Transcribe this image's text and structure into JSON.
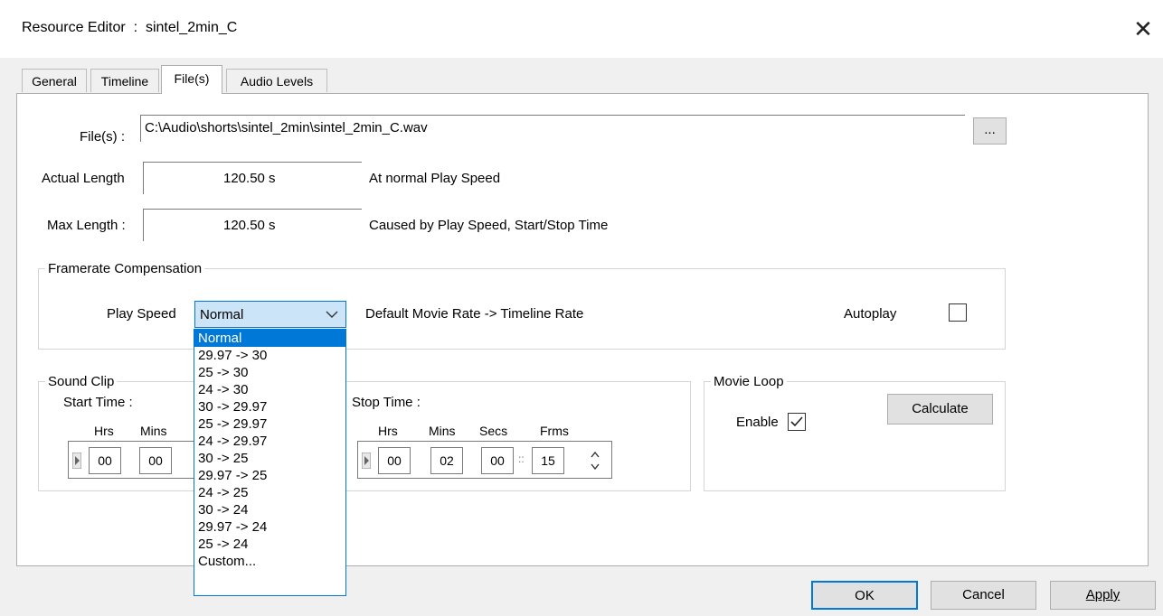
{
  "window": {
    "title": "Resource Editor  :  sintel_2min_C",
    "close": "✕"
  },
  "tabs": [
    {
      "label": "General"
    },
    {
      "label": "Timeline"
    },
    {
      "label": "File(s)"
    },
    {
      "label": "Audio Levels"
    }
  ],
  "files": {
    "label": "File(s) :",
    "value": "C:\\Audio\\shorts\\sintel_2min\\sintel_2min_C.wav",
    "browse": "..."
  },
  "actual_length": {
    "label": "Actual Length",
    "value": "120.50 s",
    "note": "At normal Play Speed"
  },
  "max_length": {
    "label": "Max Length :",
    "value": "120.50 s",
    "note": "Caused by Play Speed, Start/Stop Time"
  },
  "framerate": {
    "group_title": "Framerate Compensation",
    "play_speed_label": "Play Speed",
    "play_speed_value": "Normal",
    "rate_note": "Default Movie Rate -> Timeline Rate",
    "autoplay_label": "Autoplay",
    "autoplay_checked": false
  },
  "dropdown_options": [
    "Normal",
    "29.97 -> 30",
    "25 -> 30",
    "24 -> 30",
    "30 -> 29.97",
    "25 -> 29.97",
    "24 -> 29.97",
    "30 -> 25",
    "29.97 -> 25",
    "24 -> 25",
    "30 -> 24",
    "29.97 -> 24",
    "25 -> 24",
    "Custom..."
  ],
  "sound_clip": {
    "group_title": "Sound Clip",
    "start_label": "Start Time :",
    "start_cols": {
      "hrs": "Hrs",
      "mins": "Mins"
    },
    "start_values": {
      "hrs": "00",
      "mins": "00"
    },
    "stop_label": "Stop Time :",
    "stop_cols": {
      "hrs": "Hrs",
      "mins": "Mins",
      "secs": "Secs",
      "frms": "Frms"
    },
    "stop_values": {
      "hrs": "00",
      "mins": "02",
      "secs": "00",
      "frms": "15"
    }
  },
  "movie_loop": {
    "group_title": "Movie Loop",
    "enable_label": "Enable",
    "enable_checked": true,
    "calculate": "Calculate"
  },
  "footer": {
    "ok": "OK",
    "cancel": "Cancel",
    "apply": "Apply"
  }
}
